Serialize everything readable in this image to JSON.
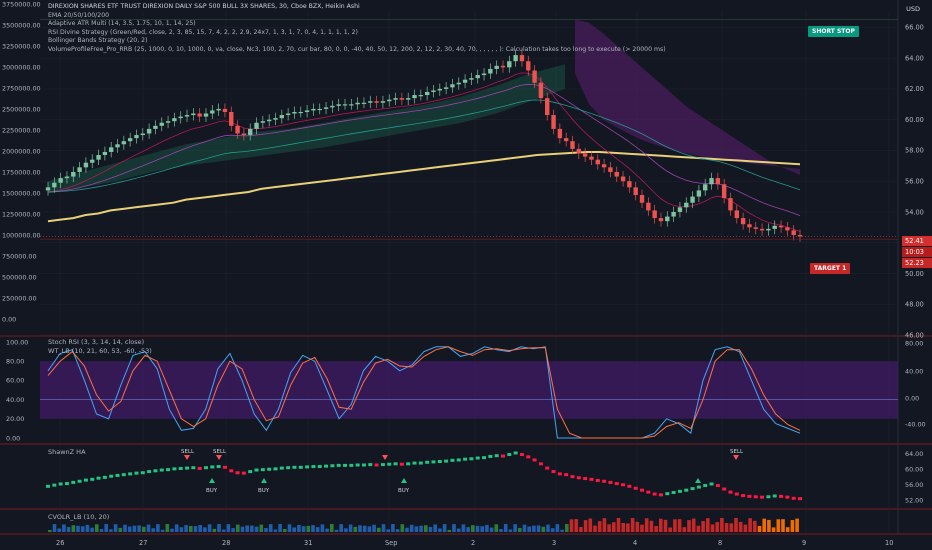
{
  "legend": {
    "title": "DIREXION SHARES ETF TRUST DIREXION DAILY S&P 500 BULL 3X SHARES, 30, Cboe BZX, Heikin Ashi",
    "indicators": [
      "EMA 20/50/100/200",
      "Adaptive ATR Multi (14, 3.5, 1.75, 10, 1, 14, 25)",
      "RSI Divine Strategy (Green/Red, close, 2, 3, 85, 15, 7, 4, 2, 2, 2.9, 24x7, 1, 3, 1, 7, 0, 4, 1, 1, 1, 1, 2)",
      "Bollinger Bands Strategy (20, 2)",
      "VolumeProfileFree_Pro_RRB (25, 1000, 0, 10, 1000, 0, va, close, Nc3, 100, 2, 70, cur bar, 80, 0, 0, -40, 40, 50, 12, 200, 2, 12, 2, 30, 40, 70, , , , , , ): Calculation takes too long to execute (> 20000 ms)"
    ]
  },
  "panes": {
    "stoch_label": "Stoch RSI (3, 3, 14, 14, close)",
    "wt_label": "WT_LB (10, 21, 60, 53, -60, -53)",
    "ha_label": "ShawnZ HA",
    "vol_label": "CVOLR_LB (10, 20)"
  },
  "badges": {
    "short_stop": "SHORT STOP",
    "target": "TARGET 1"
  },
  "price_tags": {
    "last": "52.41",
    "countdown": "10:03",
    "target": "52.23"
  },
  "currency": "USD",
  "colors": {
    "up": "#26a69a",
    "down": "#ef5350",
    "bg": "#131722",
    "grid": "#1e222d",
    "ema200": "#e8d079",
    "cloud": "#4a1d5c",
    "stoch_fill": "#3d1a63"
  },
  "chart_data": {
    "type": "line",
    "x_ticks": [
      "26",
      "27",
      "28",
      "31",
      "Sep",
      "2",
      "3",
      "4",
      "8",
      "9",
      "10"
    ],
    "left_axis_ticks": [
      "3750000.00",
      "3500000.00",
      "3250000.00",
      "3000000.00",
      "2750000.00",
      "2500000.00",
      "2250000.00",
      "2000000.00",
      "1750000.00",
      "1500000.00",
      "1250000.00",
      "1000000.00",
      "750000.00",
      "500000.00",
      "250000.00",
      "0.00"
    ],
    "right_axis_ticks": [
      "66.00",
      "64.00",
      "62.00",
      "60.00",
      "58.00",
      "56.00",
      "54.00",
      "52.00",
      "50.00",
      "48.00",
      "46.00"
    ],
    "price_close": [
      55.6,
      55.9,
      56.2,
      56.3,
      56.6,
      56.9,
      57.2,
      57.4,
      57.7,
      57.9,
      58.2,
      58.4,
      58.6,
      58.8,
      59.0,
      59.1,
      59.4,
      59.6,
      59.8,
      59.9,
      60.1,
      60.2,
      60.3,
      60.4,
      60.2,
      60.4,
      60.6,
      60.7,
      60.5,
      59.6,
      59.1,
      59.0,
      59.4,
      59.8,
      59.9,
      60.0,
      60.1,
      60.3,
      60.4,
      60.5,
      60.5,
      60.6,
      60.7,
      60.7,
      60.8,
      60.9,
      61.0,
      61.0,
      61.0,
      61.1,
      61.1,
      61.2,
      61.1,
      61.2,
      61.3,
      61.4,
      61.3,
      61.4,
      61.6,
      61.6,
      61.8,
      61.9,
      62.0,
      62.1,
      62.3,
      62.4,
      62.6,
      62.7,
      62.9,
      63.0,
      63.3,
      63.5,
      63.4,
      63.8,
      64.2,
      63.8,
      63.2,
      62.4,
      61.4,
      60.3,
      59.4,
      58.8,
      58.6,
      58.1,
      57.8,
      57.6,
      57.4,
      57.1,
      56.9,
      56.6,
      56.3,
      56.0,
      55.6,
      55.1,
      54.6,
      54.1,
      53.6,
      53.4,
      53.7,
      54.0,
      54.3,
      54.6,
      55.0,
      55.4,
      55.8,
      56.2,
      55.8,
      54.9,
      54.1,
      53.6,
      53.2,
      53.0,
      52.9,
      52.8,
      52.9,
      53.1,
      53.0,
      52.8,
      52.5,
      52.41
    ],
    "ema200": [
      53.4,
      53.5,
      53.6,
      53.8,
      53.9,
      54.1,
      54.2,
      54.3,
      54.4,
      54.5,
      54.6,
      54.8,
      54.9,
      55.0,
      55.1,
      55.2,
      55.3,
      55.5,
      55.6,
      55.7,
      55.8,
      55.9,
      56.0,
      56.1,
      56.2,
      56.3,
      56.4,
      56.5,
      56.6,
      56.7,
      56.8,
      56.9,
      57.0,
      57.1,
      57.2,
      57.3,
      57.4,
      57.5,
      57.6,
      57.7,
      57.75,
      57.8,
      57.85,
      57.9,
      57.9,
      57.85,
      57.8,
      57.75,
      57.7,
      57.65,
      57.6,
      57.55,
      57.5,
      57.45,
      57.4,
      57.35,
      57.3,
      57.25,
      57.2,
      57.15,
      57.1
    ],
    "ylim_right": [
      46,
      67
    ],
    "stoch": {
      "levels": [
        20,
        80
      ],
      "k": [
        70,
        88,
        92,
        60,
        25,
        20,
        55,
        86,
        90,
        72,
        30,
        8,
        10,
        30,
        72,
        88,
        60,
        25,
        8,
        30,
        68,
        86,
        80,
        50,
        20,
        35,
        70,
        85,
        80,
        70,
        76,
        90,
        95,
        95,
        85,
        88,
        95,
        92,
        90,
        95,
        93,
        95,
        0,
        0,
        0,
        0,
        0,
        0,
        0,
        0,
        5,
        20,
        15,
        5,
        60,
        92,
        95,
        90,
        60,
        30,
        15,
        10,
        5
      ],
      "d": [
        65,
        80,
        90,
        75,
        45,
        28,
        38,
        70,
        86,
        80,
        50,
        20,
        12,
        20,
        55,
        80,
        72,
        40,
        18,
        22,
        55,
        78,
        84,
        62,
        32,
        30,
        58,
        78,
        82,
        75,
        74,
        85,
        92,
        95,
        90,
        86,
        92,
        93,
        91,
        93,
        94,
        94,
        30,
        5,
        0,
        0,
        0,
        0,
        0,
        0,
        2,
        12,
        16,
        10,
        40,
        80,
        92,
        92,
        72,
        45,
        25,
        14,
        8
      ]
    },
    "volume_colors_note": "green up / red down / blue neutral"
  }
}
